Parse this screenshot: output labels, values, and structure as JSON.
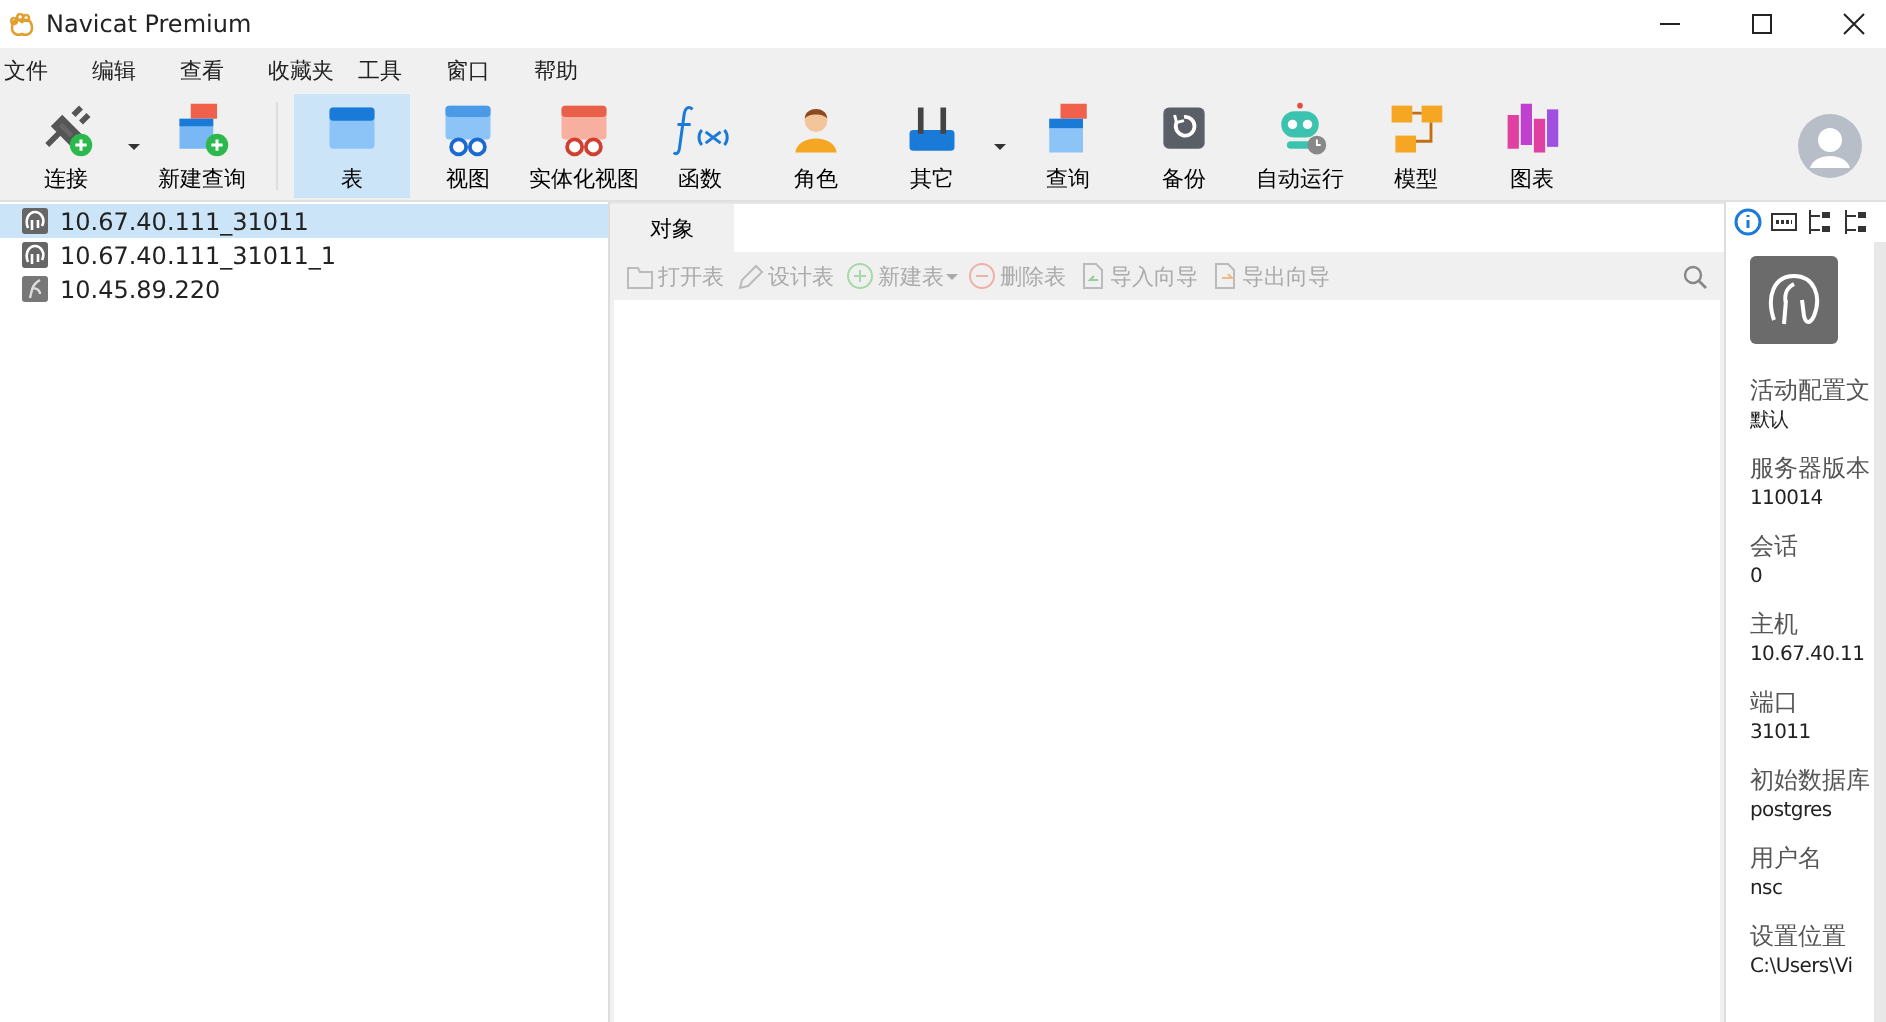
{
  "window": {
    "title": "Navicat Premium"
  },
  "menu": [
    "文件",
    "编辑",
    "查看",
    "收藏夹",
    "工具",
    "窗口",
    "帮助"
  ],
  "toolbar": [
    {
      "label": "连接",
      "kind": "plug",
      "dropdown": true,
      "selected": false
    },
    {
      "label": "新建查询",
      "kind": "newquery",
      "dropdown": false,
      "selected": false
    },
    {
      "label": "表",
      "kind": "table",
      "dropdown": false,
      "selected": true
    },
    {
      "label": "视图",
      "kind": "view",
      "dropdown": false,
      "selected": false
    },
    {
      "label": "实体化视图",
      "kind": "matview",
      "dropdown": false,
      "selected": false
    },
    {
      "label": "函数",
      "kind": "function",
      "dropdown": false,
      "selected": false
    },
    {
      "label": "角色",
      "kind": "role",
      "dropdown": false,
      "selected": false
    },
    {
      "label": "其它",
      "kind": "tools",
      "dropdown": true,
      "selected": false
    },
    {
      "label": "查询",
      "kind": "query",
      "dropdown": false,
      "selected": false
    },
    {
      "label": "备份",
      "kind": "backup",
      "dropdown": false,
      "selected": false
    },
    {
      "label": "自动运行",
      "kind": "robot",
      "dropdown": false,
      "selected": false
    },
    {
      "label": "模型",
      "kind": "model",
      "dropdown": false,
      "selected": false
    },
    {
      "label": "图表",
      "kind": "chart",
      "dropdown": false,
      "selected": false
    }
  ],
  "connections": [
    {
      "label": "10.67.40.111_31011",
      "kind": "postgres",
      "selected": true
    },
    {
      "label": "10.67.40.111_31011_1",
      "kind": "postgres",
      "selected": false
    },
    {
      "label": "10.45.89.220",
      "kind": "other",
      "selected": false
    }
  ],
  "tabs": [
    {
      "label": "对象",
      "selected": true
    }
  ],
  "object_toolbar": [
    {
      "label": "打开表",
      "kind": "folder",
      "dropdown": false,
      "disabled": true
    },
    {
      "label": "设计表",
      "kind": "pencil",
      "dropdown": false,
      "disabled": true
    },
    {
      "label": "新建表",
      "kind": "plus",
      "dropdown": true,
      "disabled": true
    },
    {
      "label": "删除表",
      "kind": "minus",
      "dropdown": false,
      "disabled": true
    },
    {
      "label": "导入向导",
      "kind": "import",
      "dropdown": false,
      "disabled": true
    },
    {
      "label": "导出向导",
      "kind": "export",
      "dropdown": false,
      "disabled": true
    }
  ],
  "info_tabs": [
    {
      "kind": "info",
      "selected": true
    },
    {
      "kind": "ddl",
      "selected": false
    },
    {
      "kind": "tree",
      "selected": false
    },
    {
      "kind": "tree2",
      "selected": false
    }
  ],
  "info": [
    {
      "label": "活动配置文",
      "value": "默认"
    },
    {
      "label": "服务器版本",
      "value": "110014"
    },
    {
      "label": "会话",
      "value": "0"
    },
    {
      "label": "主机",
      "value": "10.67.40.11"
    },
    {
      "label": "端口",
      "value": "31011"
    },
    {
      "label": "初始数据库",
      "value": "postgres"
    },
    {
      "label": "用户名",
      "value": "nsc"
    },
    {
      "label": "设置位置",
      "value": "C:\\Users\\Vi"
    }
  ]
}
